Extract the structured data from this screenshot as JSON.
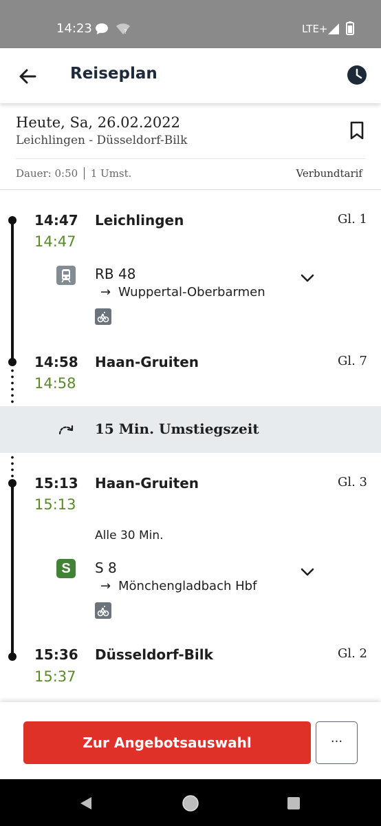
{
  "status_bar": {
    "time": "14:23",
    "network": "LTE+"
  },
  "app_bar": {
    "title": "Reiseplan"
  },
  "summary": {
    "date": "Heute, Sa, 26.02.2022",
    "route": "Leichlingen - Düsseldorf-Bilk",
    "meta": "Dauer: 0:50 │ 1 Umst.",
    "tarif": "Verbundtarif"
  },
  "legs": [
    {
      "departure": {
        "time": "14:47",
        "realtime": "14:47",
        "station": "Leichlingen",
        "platform": "Gl. 1"
      },
      "train": {
        "name": "RB 48",
        "direction": "Wuppertal-Oberbarmen"
      },
      "arrival": {
        "time": "14:58",
        "realtime": "14:58",
        "station": "Haan-Gruiten",
        "platform": "Gl. 7"
      }
    },
    {
      "departure": {
        "time": "15:13",
        "realtime": "15:13",
        "station": "Haan-Gruiten",
        "platform": "Gl. 3"
      },
      "frequency": "Alle 30 Min.",
      "train": {
        "name": "S 8",
        "direction": "Mönchengladbach Hbf",
        "badge": "S"
      },
      "arrival": {
        "time": "15:36",
        "realtime": "15:37",
        "station": "Düsseldorf-Bilk",
        "platform": "Gl. 2"
      }
    }
  ],
  "transfer": {
    "label": "15 Min. Umstiegszeit"
  },
  "footer": {
    "cta_label": "Zur Angebotsauswahl",
    "more_label": "···"
  },
  "colors": {
    "cta": "#e03128",
    "realtime": "#5a8a28",
    "sbahn": "#408335",
    "status_bar": "#8a8a8a"
  }
}
